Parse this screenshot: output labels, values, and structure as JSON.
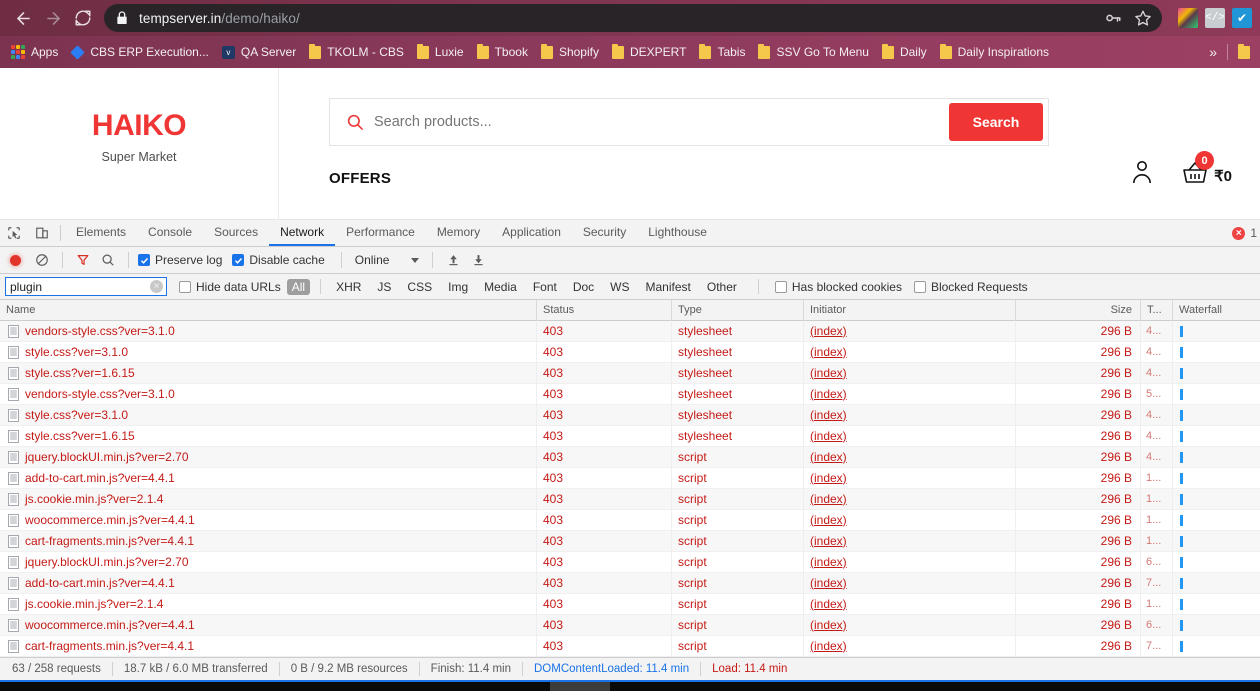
{
  "browser": {
    "url_domain": "tempserver.in",
    "url_path": "/demo/haiko/",
    "back_icon": "back-arrow-icon",
    "forward_icon": "forward-arrow-icon",
    "reload_icon": "reload-icon",
    "lock_icon": "lock-icon",
    "key_icon": "key-icon",
    "star_icon": "star-icon"
  },
  "bookmarks": [
    {
      "label": "Apps",
      "icon": "apps-grid-icon"
    },
    {
      "label": "CBS ERP Execution...",
      "icon": "diamond-icon"
    },
    {
      "label": "QA Server",
      "icon": "qa-icon"
    },
    {
      "label": "TKOLM - CBS",
      "icon": "folder-icon"
    },
    {
      "label": "Luxie",
      "icon": "folder-icon"
    },
    {
      "label": "Tbook",
      "icon": "folder-icon"
    },
    {
      "label": "Shopify",
      "icon": "folder-icon"
    },
    {
      "label": "DEXPERT",
      "icon": "folder-icon"
    },
    {
      "label": "Tabis",
      "icon": "folder-icon"
    },
    {
      "label": "SSV Go To Menu",
      "icon": "folder-icon"
    },
    {
      "label": "Daily",
      "icon": "folder-icon"
    },
    {
      "label": "Daily Inspirations",
      "icon": "folder-icon"
    }
  ],
  "bookmarks_overflow": "»",
  "site": {
    "logo_title": "HAIKO",
    "logo_subtitle": "Super Market",
    "search_placeholder": "Search products...",
    "search_value": "",
    "search_button": "Search",
    "offers_label": "OFFERS",
    "cart_count": "0",
    "cart_total": "₹0",
    "accent_color": "#f03535"
  },
  "devtools": {
    "tabs": [
      {
        "label": "Elements",
        "active": false
      },
      {
        "label": "Console",
        "active": false
      },
      {
        "label": "Sources",
        "active": false
      },
      {
        "label": "Network",
        "active": true
      },
      {
        "label": "Performance",
        "active": false
      },
      {
        "label": "Memory",
        "active": false
      },
      {
        "label": "Application",
        "active": false
      },
      {
        "label": "Security",
        "active": false
      },
      {
        "label": "Lighthouse",
        "active": false
      }
    ],
    "error_count": "1",
    "controls": {
      "record_label": "record-button",
      "clear_label": "clear-button",
      "filter_label": "filter-button",
      "search_label": "search-button",
      "preserve_log": "Preserve log",
      "preserve_log_checked": true,
      "disable_cache": "Disable cache",
      "disable_cache_checked": true,
      "throttle": "Online",
      "import_label": "import-har-button",
      "export_label": "export-har-button"
    },
    "filter": {
      "value": "plugin",
      "hide_data_urls": "Hide data URLs",
      "hide_data_urls_checked": false,
      "types": [
        "All",
        "XHR",
        "JS",
        "CSS",
        "Img",
        "Media",
        "Font",
        "Doc",
        "WS",
        "Manifest",
        "Other"
      ],
      "active_type": "All",
      "has_blocked_cookies": "Has blocked cookies",
      "has_blocked_cookies_checked": false,
      "blocked_requests": "Blocked Requests",
      "blocked_requests_checked": false
    },
    "columns": [
      "Name",
      "Status",
      "Type",
      "Initiator",
      "Size",
      "T...",
      "Waterfall"
    ],
    "rows": [
      {
        "name": "vendors-style.css?ver=3.1.0",
        "status": "403",
        "type": "stylesheet",
        "initiator": "(index)",
        "size": "296 B",
        "time": "4..."
      },
      {
        "name": "style.css?ver=3.1.0",
        "status": "403",
        "type": "stylesheet",
        "initiator": "(index)",
        "size": "296 B",
        "time": "4..."
      },
      {
        "name": "style.css?ver=1.6.15",
        "status": "403",
        "type": "stylesheet",
        "initiator": "(index)",
        "size": "296 B",
        "time": "4..."
      },
      {
        "name": "vendors-style.css?ver=3.1.0",
        "status": "403",
        "type": "stylesheet",
        "initiator": "(index)",
        "size": "296 B",
        "time": "5..."
      },
      {
        "name": "style.css?ver=3.1.0",
        "status": "403",
        "type": "stylesheet",
        "initiator": "(index)",
        "size": "296 B",
        "time": "4..."
      },
      {
        "name": "style.css?ver=1.6.15",
        "status": "403",
        "type": "stylesheet",
        "initiator": "(index)",
        "size": "296 B",
        "time": "4..."
      },
      {
        "name": "jquery.blockUI.min.js?ver=2.70",
        "status": "403",
        "type": "script",
        "initiator": "(index)",
        "size": "296 B",
        "time": "4..."
      },
      {
        "name": "add-to-cart.min.js?ver=4.4.1",
        "status": "403",
        "type": "script",
        "initiator": "(index)",
        "size": "296 B",
        "time": "1..."
      },
      {
        "name": "js.cookie.min.js?ver=2.1.4",
        "status": "403",
        "type": "script",
        "initiator": "(index)",
        "size": "296 B",
        "time": "1..."
      },
      {
        "name": "woocommerce.min.js?ver=4.4.1",
        "status": "403",
        "type": "script",
        "initiator": "(index)",
        "size": "296 B",
        "time": "1..."
      },
      {
        "name": "cart-fragments.min.js?ver=4.4.1",
        "status": "403",
        "type": "script",
        "initiator": "(index)",
        "size": "296 B",
        "time": "1..."
      },
      {
        "name": "jquery.blockUI.min.js?ver=2.70",
        "status": "403",
        "type": "script",
        "initiator": "(index)",
        "size": "296 B",
        "time": "6..."
      },
      {
        "name": "add-to-cart.min.js?ver=4.4.1",
        "status": "403",
        "type": "script",
        "initiator": "(index)",
        "size": "296 B",
        "time": "7..."
      },
      {
        "name": "js.cookie.min.js?ver=2.1.4",
        "status": "403",
        "type": "script",
        "initiator": "(index)",
        "size": "296 B",
        "time": "1..."
      },
      {
        "name": "woocommerce.min.js?ver=4.4.1",
        "status": "403",
        "type": "script",
        "initiator": "(index)",
        "size": "296 B",
        "time": "6..."
      },
      {
        "name": "cart-fragments.min.js?ver=4.4.1",
        "status": "403",
        "type": "script",
        "initiator": "(index)",
        "size": "296 B",
        "time": "7..."
      }
    ],
    "status_bar": {
      "requests": "63 / 258 requests",
      "transferred": "18.7 kB / 6.0 MB transferred",
      "resources": "0 B / 9.2 MB resources",
      "finish": "Finish: 11.4 min",
      "dom_content_loaded": "DOMContentLoaded: 11.4 min",
      "load": "Load: 11.4 min"
    }
  }
}
